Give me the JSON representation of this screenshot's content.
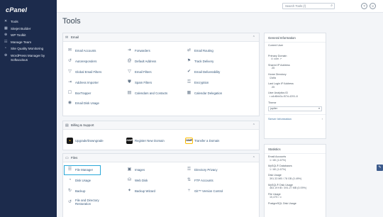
{
  "app": {
    "logo": "cPanel"
  },
  "sidebar": {
    "items": [
      {
        "icon": "tools-icon",
        "glyph": "✕",
        "label": "Tools"
      },
      {
        "icon": "sitejet-icon",
        "glyph": "▦",
        "label": "Sitejet Builder"
      },
      {
        "icon": "wordpress-icon",
        "glyph": "⊕",
        "label": "WP Toolkit"
      },
      {
        "icon": "team-icon",
        "glyph": "☷",
        "label": "Manage Team"
      },
      {
        "icon": "quality-icon",
        "glyph": "◔",
        "label": "Site Quality Monitoring"
      },
      {
        "icon": "wordpress-icon",
        "glyph": "⊕",
        "label": "WordPress Manager by\nSoftaculous"
      }
    ]
  },
  "topbar": {
    "search_placeholder": "Search Tools (/)",
    "help_glyph": "?",
    "user_glyph": "☺"
  },
  "page": {
    "title": "Tools"
  },
  "sections": {
    "email": {
      "title": "Email",
      "tools": [
        {
          "label": "Email Accounts",
          "glyph": "✉"
        },
        {
          "label": "Forwarders",
          "glyph": "➜"
        },
        {
          "label": "Email Routing",
          "glyph": "⇄"
        },
        {
          "label": "Autoresponders",
          "glyph": "↺"
        },
        {
          "label": "Default Address",
          "glyph": "@"
        },
        {
          "label": "Track Delivery",
          "glyph": "⚑"
        },
        {
          "label": "Global Email Filters",
          "glyph": "▽"
        },
        {
          "label": "Email Filters",
          "glyph": "▽"
        },
        {
          "label": "Email Deliverability",
          "glyph": "✔"
        },
        {
          "label": "Address Importer",
          "glyph": "⇥"
        },
        {
          "label": "Spam Filters",
          "glyph": "⛊"
        },
        {
          "label": "Encryption",
          "glyph": "⚿"
        },
        {
          "label": "BoxTrapper",
          "glyph": "☐"
        },
        {
          "label": "Calendars and Contacts",
          "glyph": "▤"
        },
        {
          "label": "Calendar Delegation",
          "glyph": "▦"
        },
        {
          "label": "Email Disk Usage",
          "glyph": "◉"
        }
      ]
    },
    "billing": {
      "title": "Billing & Support",
      "tools": [
        {
          "label": "Upgrade/Downgrade",
          "brand": ""
        },
        {
          "label": "Register New Domain",
          "brand": "JUMP"
        },
        {
          "label": "Transfer a Domain",
          "brand": "JUMP"
        }
      ]
    },
    "files": {
      "title": "Files",
      "tools": [
        {
          "label": "File Manager",
          "glyph": "☰"
        },
        {
          "label": "Images",
          "glyph": "▣"
        },
        {
          "label": "Directory Privacy",
          "glyph": "⚿"
        },
        {
          "label": "Disk Usage",
          "glyph": "◔"
        },
        {
          "label": "Web Disk",
          "glyph": "⛁"
        },
        {
          "label": "FTP Accounts",
          "glyph": "⇅"
        },
        {
          "label": "Backup",
          "glyph": "↻"
        },
        {
          "label": "Backup Wizard",
          "glyph": "✦"
        },
        {
          "label": "Git™ Version Control",
          "glyph": "⑂"
        },
        {
          "label": "File and Directory\nRestoration",
          "glyph": "↺"
        }
      ]
    }
  },
  "general_info": {
    "title": "General Information",
    "current_user_label": "Current User",
    "primary_domain_label": "Primary Domain",
    "primary_domain_value": "com",
    "shared_ip_label": "Shared IP Address",
    "shared_ip_value": ".35",
    "home_dir_label": "Home Directory",
    "home_dir_value": "/2alfa",
    "last_login_label": "Last Login IP Address",
    "last_login_value": ".35",
    "user_analytics_label": "User Analytics ID",
    "user_analytics_value": "a4d6bb3c-f07d-4291-8",
    "theme_label": "Theme",
    "theme_value": "jupiter",
    "server_info_label": "Server Information"
  },
  "statistics": {
    "title": "Statistics",
    "items": [
      {
        "label": "Email Accounts",
        "value": "1 / 80  (1.67%)"
      },
      {
        "label": "MySQL® Databases",
        "value": "1 / 80  (1.67%)"
      },
      {
        "label": "Disk Usage",
        "value": "391.33 MB / 78 GB  (0.49%)"
      },
      {
        "label": "MySQL® Disk Usage",
        "value": "463.19 KB / 391.27 MB  (0.09%)"
      },
      {
        "label": "File Usage",
        "value": "10,475 / ∞"
      },
      {
        "label": "PostgreSQL Disk Usage",
        "value": ""
      }
    ]
  },
  "colors": {
    "sidebar": "#1c2b4c",
    "accent": "#2aa8d8",
    "link": "#35577a"
  }
}
